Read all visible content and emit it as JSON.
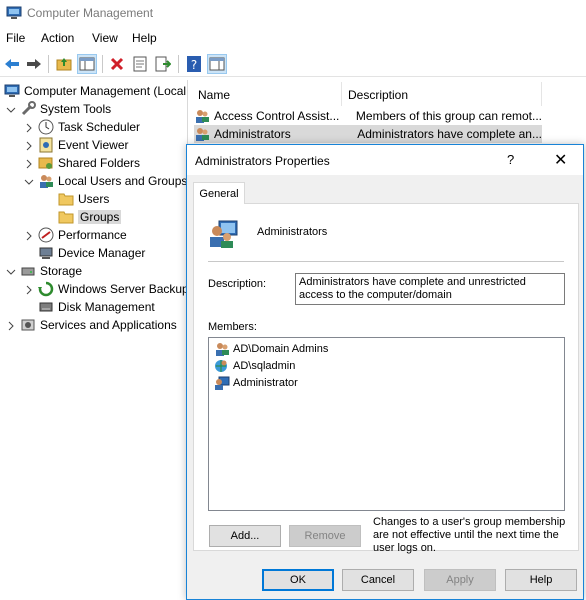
{
  "window": {
    "title": "Computer Management",
    "app_icon": "computer-management-icon"
  },
  "menu": [
    "File",
    "Action",
    "View",
    "Help"
  ],
  "toolbar": {
    "icons": [
      "back-arrow-icon",
      "forward-arrow-icon",
      "up-folder-icon",
      "show-hide-tree-icon",
      "delete-icon",
      "properties-icon",
      "export-list-icon",
      "help-icon",
      "show-hide-action-pane-icon"
    ]
  },
  "tree": {
    "root": "Computer Management (Local",
    "system_tools": "System Tools",
    "task_scheduler": "Task Scheduler",
    "event_viewer": "Event Viewer",
    "shared_folders": "Shared Folders",
    "local_users_groups": "Local Users and Groups",
    "users": "Users",
    "groups": "Groups",
    "performance": "Performance",
    "device_manager": "Device Manager",
    "storage": "Storage",
    "windows_server_backup": "Windows Server Backup",
    "disk_management": "Disk Management",
    "services_apps": "Services and Applications"
  },
  "list": {
    "columns": [
      "Name",
      "Description"
    ],
    "rows": [
      {
        "name": "Access Control Assist...",
        "description": "Members of this group can remot..."
      },
      {
        "name": "Administrators",
        "description": "Administrators have complete an..."
      }
    ]
  },
  "dialog": {
    "title": "Administrators Properties",
    "help": "?",
    "close": "✕",
    "tab": "General",
    "group_name": "Administrators",
    "description_label": "Description:",
    "description_value": "Administrators have complete and unrestricted access to the computer/domain",
    "members_label": "Members:",
    "members": [
      {
        "name": "AD\\Domain Admins",
        "icon": "domain-group-icon"
      },
      {
        "name": "AD\\sqladmin",
        "icon": "domain-user-icon"
      },
      {
        "name": "Administrator",
        "icon": "local-user-icon"
      }
    ],
    "add_button": "Add...",
    "remove_button": "Remove",
    "note": "Changes to a user's group membership are not effective until the next time the user logs on.",
    "ok": "OK",
    "cancel": "Cancel",
    "apply": "Apply",
    "help_button": "Help"
  },
  "colors": {
    "accent": "#0078d7",
    "selection": "#d9d9d9",
    "toolbar_pressed": "#cce4f7"
  }
}
